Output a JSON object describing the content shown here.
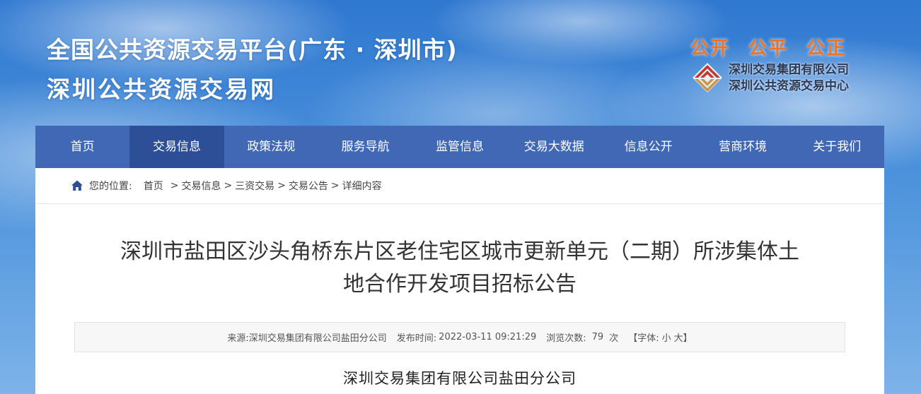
{
  "header": {
    "title_line1": "全国公共资源交易平台(广东 · 深圳市)",
    "title_line2": "深圳公共资源交易网",
    "slogan": [
      "公开",
      "公平",
      "公正"
    ],
    "org_names": [
      "深圳交易集团有限公司",
      "深圳公共资源交易中心"
    ]
  },
  "nav": {
    "items": [
      "首页",
      "交易信息",
      "政策法规",
      "服务导航",
      "监管信息",
      "交易大数据",
      "信息公开",
      "营商环境",
      "关于我们"
    ],
    "active_index": 1
  },
  "breadcrumb": {
    "label": "您的位置:",
    "items": [
      "首页",
      "交易信息",
      "三资交易",
      "交易公告",
      "详细内容"
    ],
    "separator": ">"
  },
  "article": {
    "title_line1": "深圳市盐田区沙头角桥东片区老住宅区城市更新单元（二期）所涉集体土",
    "title_line2": "地合作开发项目招标公告",
    "meta": {
      "source_label": "来源:",
      "source": "深圳交易集团有限公司盐田分公司",
      "publish_label": "发布时间:",
      "publish_time": "2022-03-11 09:21:29",
      "views_label": "浏览次数:",
      "views": "79",
      "views_unit": "次",
      "font_label": "【字体:",
      "font_small": "小",
      "font_large": "大】"
    },
    "body_heading": "深圳交易集团有限公司盐田分公司"
  },
  "colors": {
    "nav_bg": "#4068b4",
    "nav_active": "#2c4f97",
    "slogan": "#e8762a",
    "logo_red": "#c0392b",
    "logo_gold": "#c9964a"
  }
}
